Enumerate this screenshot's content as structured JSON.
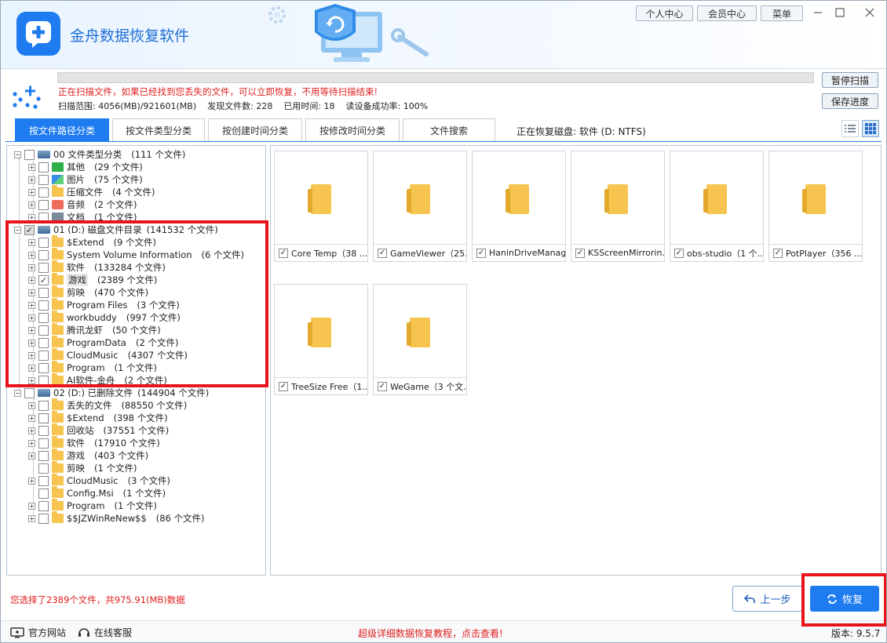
{
  "app": {
    "title": "金舟数据恢复软件"
  },
  "top_buttons": {
    "personal": "个人中心",
    "member": "会员中心",
    "menu": "菜单"
  },
  "scan": {
    "message": "正在扫描文件，如果已经找到您丢失的文件，可以立即恢复，不用等待扫描结束!",
    "range": "扫描范围: 4056(MB)/921601(MB)",
    "found": "发现文件数: 228",
    "elapsed": "已用时间: 18",
    "read_rate": "读设备成功率: 100%",
    "pause_label": "暂停扫描",
    "save_label": "保存进度",
    "progress": 0
  },
  "tabs": [
    "按文件路径分类",
    "按文件类型分类",
    "按创建时间分类",
    "按修改时间分类",
    "文件搜索"
  ],
  "disk_label": "正在恢复磁盘: 软件 (D: NTFS)",
  "tree": [
    {
      "label": "00 文件类型分类",
      "count": "(111 个文件)"
    },
    {
      "label": "其他",
      "count": "(29 个文件)"
    },
    {
      "label": "图片",
      "count": "(75 个文件)"
    },
    {
      "label": "压缩文件",
      "count": "(4 个文件)"
    },
    {
      "label": "音频",
      "count": "(2 个文件)"
    },
    {
      "label": "文档",
      "count": "(1 个文件)"
    },
    {
      "label": "01 (D:) 磁盘文件目录",
      "count": "(141532 个文件)"
    },
    {
      "label": "$Extend",
      "count": "(9 个文件)"
    },
    {
      "label": "System Volume Information",
      "count": "(6 个文件)"
    },
    {
      "label": "软件",
      "count": "(133284 个文件)"
    },
    {
      "label": "游戏",
      "count": "(2389 个文件)"
    },
    {
      "label": "剪映",
      "count": "(470 个文件)"
    },
    {
      "label": "Program Files",
      "count": "(3 个文件)"
    },
    {
      "label": "workbuddy",
      "count": "(997 个文件)"
    },
    {
      "label": "腾讯龙虾",
      "count": "(50 个文件)"
    },
    {
      "label": "ProgramData",
      "count": "(2 个文件)"
    },
    {
      "label": "CloudMusic",
      "count": "(4307 个文件)"
    },
    {
      "label": "Program",
      "count": "(1 个文件)"
    },
    {
      "label": "AI软件-金舟",
      "count": "(2 个文件)"
    },
    {
      "label": "02 (D:) 已删除文件",
      "count": "(144904 个文件)"
    },
    {
      "label": "丢失的文件",
      "count": "(88550 个文件)"
    },
    {
      "label": "$Extend",
      "count": "(398 个文件)"
    },
    {
      "label": "回收站",
      "count": "(37551 个文件)"
    },
    {
      "label": "软件",
      "count": "(17910 个文件)"
    },
    {
      "label": "游戏",
      "count": "(403 个文件)"
    },
    {
      "label": "剪映",
      "count": "(1 个文件)"
    },
    {
      "label": "CloudMusic",
      "count": "(3 个文件)"
    },
    {
      "label": "Config.Msi",
      "count": "(1 个文件)"
    },
    {
      "label": "Program",
      "count": "(1 个文件)"
    },
    {
      "label": "$$JZWinReNew$$",
      "count": "(86 个文件)"
    }
  ],
  "files": [
    "Core Temp（38 ...",
    "GameViewer（25...",
    "HaninDriveManag...",
    "KSScreenMirrorin...",
    "obs-studio（1 个...",
    "PotPlayer（356 ...",
    "TreeSize Free（1...",
    "WeGame（3 个文..."
  ],
  "status": {
    "selection": "您选择了2389个文件，共975.91(MB)数据"
  },
  "buttons": {
    "back": "上一步",
    "restore": "恢复"
  },
  "footer": {
    "website": "官方网站",
    "support": "在线客服",
    "tutorial": "超级详细数据恢复教程，点击查看!",
    "version": "版本: 9.5.7"
  },
  "colors": {
    "accent": "#1f7cf0",
    "warning": "#e02020",
    "highlight_box": "#e8141a",
    "folder": "#f6c44f"
  }
}
